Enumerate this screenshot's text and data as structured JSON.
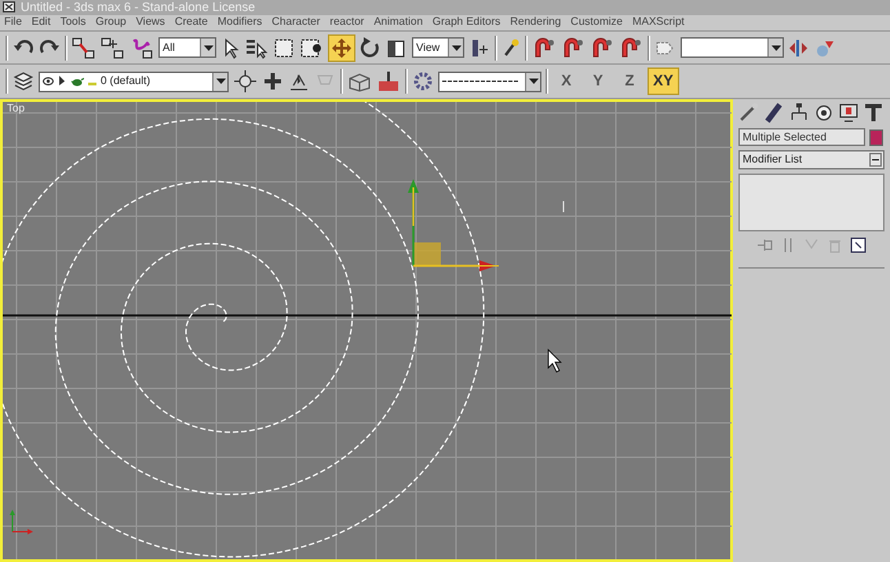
{
  "window": {
    "title": "Untitled - 3ds max 6 - Stand-alone License"
  },
  "menu": [
    "File",
    "Edit",
    "Tools",
    "Group",
    "Views",
    "Create",
    "Modifiers",
    "Character",
    "reactor",
    "Animation",
    "Graph Editors",
    "Rendering",
    "Customize",
    "MAXScript"
  ],
  "main_toolbar": {
    "selection_filter": "All",
    "reference_coordinate": "View",
    "move_tool": {
      "selected": true
    }
  },
  "layer_toolbar": {
    "layer": "0 (default)",
    "axis_constraints": [
      {
        "label": "X",
        "selected": false
      },
      {
        "label": "Y",
        "selected": false
      },
      {
        "label": "Z",
        "selected": false
      },
      {
        "label": "XY",
        "selected": true
      }
    ]
  },
  "viewport": {
    "label": "Top",
    "active": true
  },
  "command_panel": {
    "object_name": "Multiple Selected",
    "modifier_list": "Modifier List"
  }
}
